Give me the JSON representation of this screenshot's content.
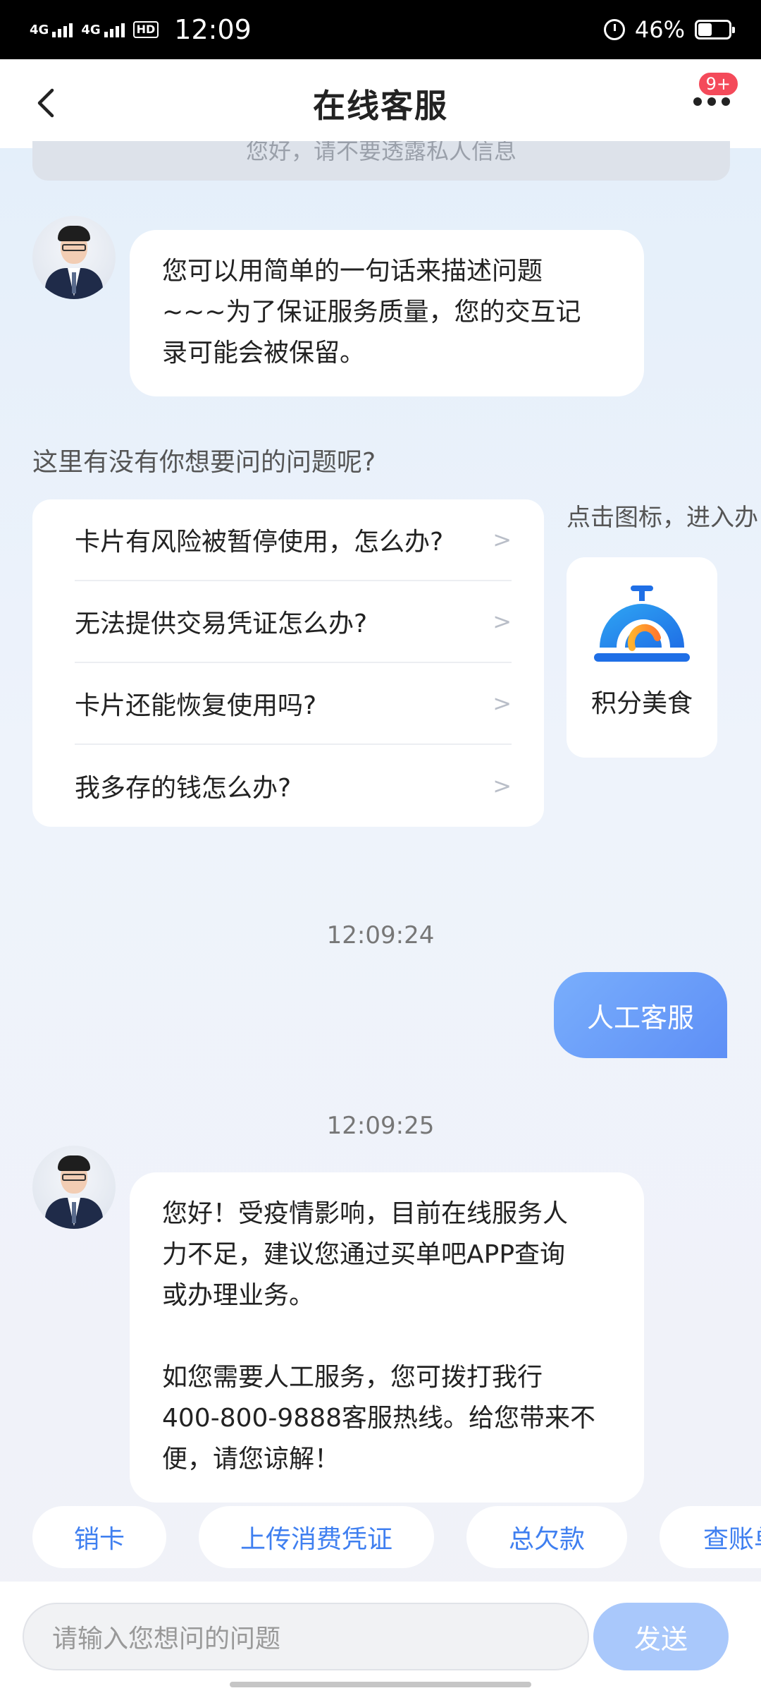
{
  "status_bar": {
    "network1": "4G",
    "network2": "4G",
    "hd_label": "HD",
    "time": "12:09",
    "battery_percent": "46%",
    "battery_level": 0.46
  },
  "header": {
    "title": "在线客服",
    "badge": "9+"
  },
  "notice": "您好，请不要透露私人信息",
  "messages": {
    "bot_intro": "您可以用简单的一句话来描述问题\n~~~为了保证服务质量，您的交互记\n录可能会被保留。",
    "prompt": "这里有没有你想要问的问题呢?",
    "faq": [
      "卡片有风险被暂停使用，怎么办?",
      "无法提供交易凭证怎么办?",
      "卡片还能恢复使用吗?",
      "我多存的钱怎么办?"
    ],
    "faq_chevron": ">",
    "hint": "点击图标，进入办",
    "food_label": "积分美食",
    "time1": "12:09:24",
    "user_message": "人工客服",
    "time2": "12:09:25",
    "bot_reply": "您好！受疫情影响，目前在线服务人\n力不足，建议您通过买单吧APP查询\n或办理业务。\n\n如您需要人工服务，您可拨打我行\n400-800-9888客服热线。给您带来不\n便，请您谅解！"
  },
  "chips": [
    "销卡",
    "上传消费凭证",
    "总欠款",
    "查账单"
  ],
  "input": {
    "placeholder": "请输入您想问的问题",
    "send_label": "发送"
  },
  "colors": {
    "accent": "#3f7ff0",
    "user_bubble": "#6a9cf8",
    "send_button": "#a9c8fb",
    "badge": "#f44a5a"
  }
}
